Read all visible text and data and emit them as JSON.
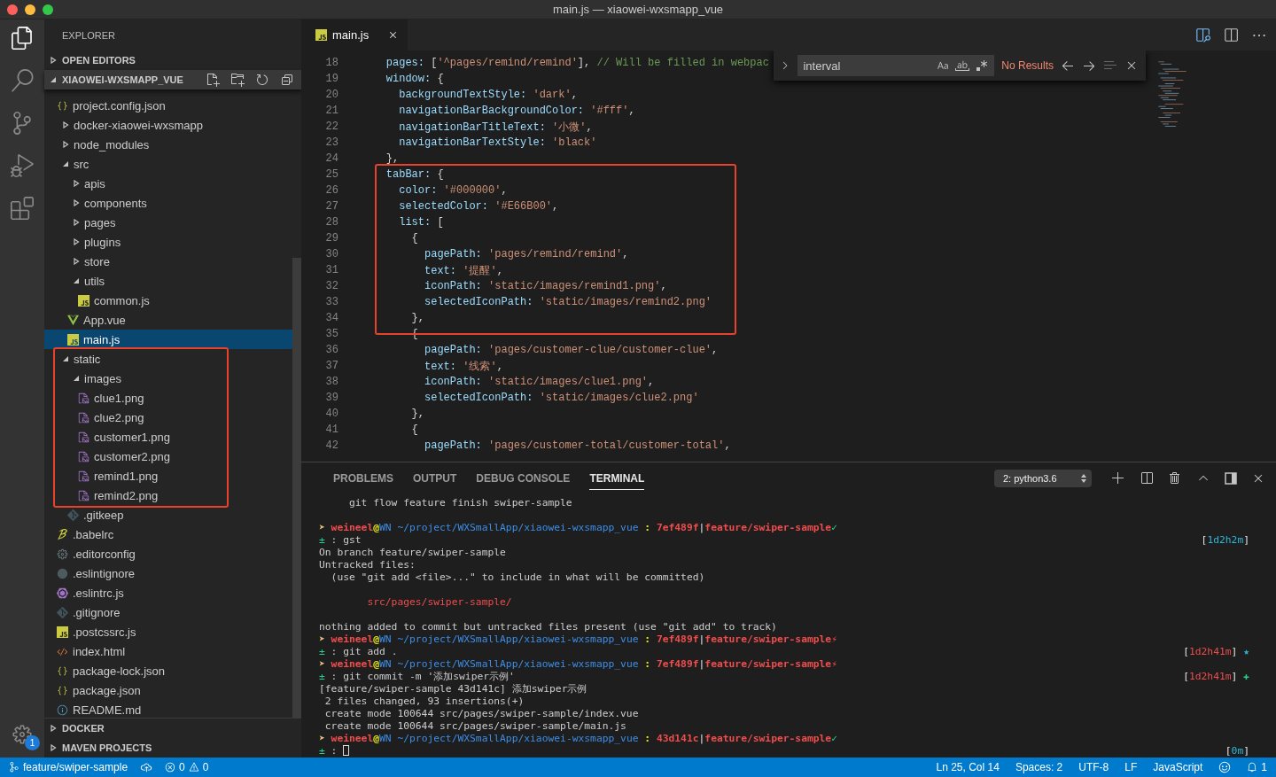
{
  "window": {
    "title": "main.js — xiaowei-wxsmapp_vue"
  },
  "activity_bar": {
    "items": [
      {
        "kind": "files",
        "selected": true
      },
      {
        "kind": "search",
        "selected": false
      },
      {
        "kind": "scm",
        "selected": false
      },
      {
        "kind": "debug",
        "selected": false
      },
      {
        "kind": "extensions",
        "selected": false
      }
    ],
    "settings_badge": "1"
  },
  "sidebar": {
    "title": "EXPLORER",
    "sections": [
      {
        "label": "OPEN EDITORS",
        "expanded": false
      },
      {
        "label": "XIAOWEI-WXSMAPP_VUE",
        "expanded": true
      }
    ],
    "tree": [
      {
        "name": "project.config.json",
        "kind": "json",
        "selected": false,
        "annotated": false
      },
      {
        "name": "docker-xiaowei-wxsmapp",
        "kind": "folder",
        "expanded": false,
        "selected": false,
        "annotated": false
      },
      {
        "name": "node_modules",
        "kind": "folder",
        "expanded": false,
        "selected": false,
        "annotated": false
      },
      {
        "name": "src",
        "kind": "folder",
        "expanded": true,
        "selected": false,
        "annotated": false,
        "children": [
          {
            "name": "apis",
            "kind": "folder",
            "expanded": false,
            "selected": false,
            "annotated": false
          },
          {
            "name": "components",
            "kind": "folder",
            "expanded": false,
            "selected": false,
            "annotated": false
          },
          {
            "name": "pages",
            "kind": "folder",
            "expanded": false,
            "selected": false,
            "annotated": false
          },
          {
            "name": "plugins",
            "kind": "folder",
            "expanded": false,
            "selected": false,
            "annotated": false
          },
          {
            "name": "store",
            "kind": "folder",
            "expanded": false,
            "selected": false,
            "annotated": false
          },
          {
            "name": "utils",
            "kind": "folder",
            "expanded": true,
            "selected": false,
            "annotated": false,
            "children": [
              {
                "name": "common.js",
                "kind": "js",
                "selected": false,
                "annotated": false
              }
            ]
          },
          {
            "name": "App.vue",
            "kind": "vue",
            "selected": false,
            "annotated": false
          },
          {
            "name": "main.js",
            "kind": "js",
            "selected": true,
            "annotated": false
          }
        ]
      },
      {
        "name": "static",
        "kind": "folder",
        "expanded": true,
        "selected": false,
        "annotated": true,
        "children": [
          {
            "name": "images",
            "kind": "folder",
            "expanded": true,
            "selected": false,
            "annotated": true,
            "children": [
              {
                "name": "clue1.png",
                "kind": "image",
                "selected": false,
                "annotated": true
              },
              {
                "name": "clue2.png",
                "kind": "image",
                "selected": false,
                "annotated": true
              },
              {
                "name": "customer1.png",
                "kind": "image",
                "selected": false,
                "annotated": true
              },
              {
                "name": "customer2.png",
                "kind": "image",
                "selected": false,
                "annotated": true
              },
              {
                "name": "remind1.png",
                "kind": "image",
                "selected": false,
                "annotated": true
              },
              {
                "name": "remind2.png",
                "kind": "image",
                "selected": false,
                "annotated": true
              }
            ]
          },
          {
            "name": ".gitkeep",
            "kind": "git",
            "selected": false,
            "annotated": false
          }
        ]
      },
      {
        "name": ".babelrc",
        "kind": "babel",
        "selected": false,
        "annotated": false
      },
      {
        "name": ".editorconfig",
        "kind": "gear",
        "selected": false,
        "annotated": false
      },
      {
        "name": ".eslintignore",
        "kind": "dot",
        "selected": false,
        "annotated": false
      },
      {
        "name": ".eslintrc.js",
        "kind": "eslint",
        "selected": false,
        "annotated": false
      },
      {
        "name": ".gitignore",
        "kind": "git",
        "selected": false,
        "annotated": false
      },
      {
        "name": ".postcssrc.js",
        "kind": "js",
        "selected": false,
        "annotated": false
      },
      {
        "name": "index.html",
        "kind": "html",
        "selected": false,
        "annotated": false
      },
      {
        "name": "package-lock.json",
        "kind": "json",
        "selected": false,
        "annotated": false
      },
      {
        "name": "package.json",
        "kind": "json",
        "selected": false,
        "annotated": false
      },
      {
        "name": "README.md",
        "kind": "info",
        "selected": false,
        "annotated": false
      }
    ],
    "bottom_sections": [
      {
        "label": "DOCKER",
        "expanded": false
      },
      {
        "label": "MAVEN PROJECTS",
        "expanded": false
      }
    ]
  },
  "editor": {
    "tabs": [
      {
        "label": "main.js",
        "kind": "js",
        "selected": true
      }
    ],
    "find": {
      "value": "interval",
      "result": "No Results"
    },
    "blocks": [
      {
        "annotated": false,
        "lines": [
          {
            "number": "18",
            "tokens": [
              {
                "kind": "key",
                "text": "    pages:"
              },
              {
                "kind": "punct",
                "text": " ["
              },
              {
                "kind": "str",
                "text": "'^pages/remind/remind'"
              },
              {
                "kind": "punct",
                "text": "],"
              },
              {
                "kind": "comment",
                "text": " // Will be filled in webpac"
              }
            ]
          },
          {
            "number": "19",
            "tokens": [
              {
                "kind": "key",
                "text": "    window:"
              },
              {
                "kind": "punct",
                "text": " {"
              }
            ]
          },
          {
            "number": "20",
            "tokens": [
              {
                "kind": "key",
                "text": "      backgroundTextStyle:"
              },
              {
                "kind": "str",
                "text": " 'dark'"
              },
              {
                "kind": "punct",
                "text": ","
              }
            ]
          },
          {
            "number": "21",
            "tokens": [
              {
                "kind": "key",
                "text": "      navigationBarBackgroundColor:"
              },
              {
                "kind": "str",
                "text": " '#fff'"
              },
              {
                "kind": "punct",
                "text": ","
              }
            ]
          },
          {
            "number": "22",
            "tokens": [
              {
                "kind": "key",
                "text": "      navigationBarTitleText:"
              },
              {
                "kind": "str",
                "text": " '小微'"
              },
              {
                "kind": "punct",
                "text": ","
              }
            ]
          },
          {
            "number": "23",
            "tokens": [
              {
                "kind": "key",
                "text": "      navigationBarTextStyle:"
              },
              {
                "kind": "str",
                "text": " 'black'"
              }
            ]
          },
          {
            "number": "24",
            "tokens": [
              {
                "kind": "punct",
                "text": "    },"
              }
            ]
          }
        ]
      },
      {
        "annotated": true,
        "lines": [
          {
            "number": "25",
            "tokens": [
              {
                "kind": "key",
                "text": "    tabBar:"
              },
              {
                "kind": "punct",
                "text": " {"
              }
            ]
          },
          {
            "number": "26",
            "tokens": [
              {
                "kind": "key",
                "text": "      color:"
              },
              {
                "kind": "str",
                "text": " '#000000'"
              },
              {
                "kind": "punct",
                "text": ","
              }
            ]
          },
          {
            "number": "27",
            "tokens": [
              {
                "kind": "key",
                "text": "      selectedColor:"
              },
              {
                "kind": "str",
                "text": " '#E66B00'"
              },
              {
                "kind": "punct",
                "text": ","
              }
            ]
          },
          {
            "number": "28",
            "tokens": [
              {
                "kind": "key",
                "text": "      list:"
              },
              {
                "kind": "punct",
                "text": " ["
              }
            ]
          },
          {
            "number": "29",
            "tokens": [
              {
                "kind": "punct",
                "text": "        {"
              }
            ]
          },
          {
            "number": "30",
            "tokens": [
              {
                "kind": "key",
                "text": "          pagePath:"
              },
              {
                "kind": "str",
                "text": " 'pages/remind/remind'"
              },
              {
                "kind": "punct",
                "text": ","
              }
            ]
          },
          {
            "number": "31",
            "tokens": [
              {
                "kind": "key",
                "text": "          text:"
              },
              {
                "kind": "str",
                "text": " '提醒'"
              },
              {
                "kind": "punct",
                "text": ","
              }
            ]
          },
          {
            "number": "32",
            "tokens": [
              {
                "kind": "key",
                "text": "          iconPath:"
              },
              {
                "kind": "str",
                "text": " 'static/images/remind1.png'"
              },
              {
                "kind": "punct",
                "text": ","
              }
            ]
          },
          {
            "number": "33",
            "tokens": [
              {
                "kind": "key",
                "text": "          selectedIconPath:"
              },
              {
                "kind": "str",
                "text": " 'static/images/remind2.png'"
              }
            ]
          },
          {
            "number": "34",
            "tokens": [
              {
                "kind": "punct",
                "text": "        },"
              }
            ]
          },
          {
            "number": "35",
            "tokens": [
              {
                "kind": "punct",
                "text": "        {"
              }
            ]
          }
        ]
      },
      {
        "annotated": false,
        "lines": [
          {
            "number": "36",
            "tokens": [
              {
                "kind": "key",
                "text": "          pagePath:"
              },
              {
                "kind": "str",
                "text": " 'pages/customer-clue/customer-clue'"
              },
              {
                "kind": "punct",
                "text": ","
              }
            ]
          },
          {
            "number": "37",
            "tokens": [
              {
                "kind": "key",
                "text": "          text:"
              },
              {
                "kind": "str",
                "text": " '线索'"
              },
              {
                "kind": "punct",
                "text": ","
              }
            ]
          },
          {
            "number": "38",
            "tokens": [
              {
                "kind": "key",
                "text": "          iconPath:"
              },
              {
                "kind": "str",
                "text": " 'static/images/clue1.png'"
              },
              {
                "kind": "punct",
                "text": ","
              }
            ]
          },
          {
            "number": "39",
            "tokens": [
              {
                "kind": "key",
                "text": "          selectedIconPath:"
              },
              {
                "kind": "str",
                "text": " 'static/images/clue2.png'"
              }
            ]
          },
          {
            "number": "40",
            "tokens": [
              {
                "kind": "punct",
                "text": "        },"
              }
            ]
          },
          {
            "number": "41",
            "tokens": [
              {
                "kind": "punct",
                "text": "        {"
              }
            ]
          },
          {
            "number": "42",
            "tokens": [
              {
                "kind": "key",
                "text": "          pagePath:"
              },
              {
                "kind": "str",
                "text": " 'pages/customer-total/customer-total'"
              },
              {
                "kind": "punct",
                "text": ","
              }
            ]
          }
        ]
      }
    ]
  },
  "panel": {
    "tabs": [
      {
        "label": "PROBLEMS",
        "selected": false
      },
      {
        "label": "OUTPUT",
        "selected": false
      },
      {
        "label": "DEBUG CONSOLE",
        "selected": false
      },
      {
        "label": "TERMINAL",
        "selected": true
      }
    ],
    "terminal_select": "2: python3.6",
    "lines": [
      {
        "kind": "text",
        "segments": [
          {
            "kind": "plain",
            "text": "     git flow feature finish swiper-sample"
          }
        ]
      },
      {
        "kind": "blank"
      },
      {
        "kind": "text",
        "segments": [
          {
            "kind": "arrow",
            "text": "➤ "
          },
          {
            "kind": "user",
            "text": "weineel"
          },
          {
            "kind": "at",
            "text": "@"
          },
          {
            "kind": "host",
            "text": "WN"
          },
          {
            "kind": "path",
            "text": " ~/project/WXSmallApp/xiaowei-wxsmapp_vue"
          },
          {
            "kind": "sep",
            "text": " : "
          },
          {
            "kind": "hash",
            "text": "7ef489f"
          },
          {
            "kind": "bar",
            "text": "|"
          },
          {
            "kind": "branch",
            "text": "feature/swiper-sample"
          },
          {
            "kind": "ok",
            "text": "✓"
          }
        ]
      },
      {
        "kind": "text",
        "segments": [
          {
            "kind": "pm",
            "text": "±"
          },
          {
            "kind": "plain",
            "text": " : gst"
          }
        ],
        "right": [
          {
            "kind": "bracket",
            "text": "["
          },
          {
            "kind": "time_ok",
            "text": "1d2h2m"
          },
          {
            "kind": "bracket",
            "text": "]"
          }
        ]
      },
      {
        "kind": "text",
        "segments": [
          {
            "kind": "plain",
            "text": "On branch feature/swiper-sample"
          }
        ]
      },
      {
        "kind": "text",
        "segments": [
          {
            "kind": "plain",
            "text": "Untracked files:"
          }
        ]
      },
      {
        "kind": "text",
        "segments": [
          {
            "kind": "plain",
            "text": "  (use \"git add <file>...\" to include in what will be committed)"
          }
        ]
      },
      {
        "kind": "blank"
      },
      {
        "kind": "text",
        "segments": [
          {
            "kind": "untracked",
            "text": "        src/pages/swiper-sample/"
          }
        ]
      },
      {
        "kind": "blank"
      },
      {
        "kind": "text",
        "segments": [
          {
            "kind": "plain",
            "text": "nothing added to commit but untracked files present (use \"git add\" to track)"
          }
        ]
      },
      {
        "kind": "text",
        "segments": [
          {
            "kind": "arrow",
            "text": "➤ "
          },
          {
            "kind": "user",
            "text": "weineel"
          },
          {
            "kind": "at",
            "text": "@"
          },
          {
            "kind": "host",
            "text": "WN"
          },
          {
            "kind": "path",
            "text": " ~/project/WXSmallApp/xiaowei-wxsmapp_vue"
          },
          {
            "kind": "sep",
            "text": " : "
          },
          {
            "kind": "hash",
            "text": "7ef489f"
          },
          {
            "kind": "bar",
            "text": "|"
          },
          {
            "kind": "branch",
            "text": "feature/swiper-sample"
          },
          {
            "kind": "dirty",
            "text": "⚡"
          }
        ]
      },
      {
        "kind": "text",
        "segments": [
          {
            "kind": "pm",
            "text": "±"
          },
          {
            "kind": "plain",
            "text": " : git add ."
          }
        ],
        "right": [
          {
            "kind": "bracket",
            "text": "["
          },
          {
            "kind": "time_bad",
            "text": "1d2h41m"
          },
          {
            "kind": "bracket",
            "text": "]"
          },
          {
            "kind": "star",
            "text": " ★"
          }
        ]
      },
      {
        "kind": "text",
        "segments": [
          {
            "kind": "arrow",
            "text": "➤ "
          },
          {
            "kind": "user",
            "text": "weineel"
          },
          {
            "kind": "at",
            "text": "@"
          },
          {
            "kind": "host",
            "text": "WN"
          },
          {
            "kind": "path",
            "text": " ~/project/WXSmallApp/xiaowei-wxsmapp_vue"
          },
          {
            "kind": "sep",
            "text": " : "
          },
          {
            "kind": "hash",
            "text": "7ef489f"
          },
          {
            "kind": "bar",
            "text": "|"
          },
          {
            "kind": "branch",
            "text": "feature/swiper-sample"
          },
          {
            "kind": "dirty",
            "text": "⚡"
          }
        ]
      },
      {
        "kind": "text",
        "segments": [
          {
            "kind": "pm",
            "text": "±"
          },
          {
            "kind": "plain",
            "text": " : git commit -m '添加swiper示例'"
          }
        ],
        "right": [
          {
            "kind": "bracket",
            "text": "["
          },
          {
            "kind": "time_bad",
            "text": "1d2h41m"
          },
          {
            "kind": "bracket",
            "text": "]"
          },
          {
            "kind": "plus",
            "text": " ✚"
          }
        ]
      },
      {
        "kind": "text",
        "segments": [
          {
            "kind": "plain",
            "text": "[feature/swiper-sample 43d141c] 添加swiper示例"
          }
        ]
      },
      {
        "kind": "text",
        "segments": [
          {
            "kind": "plain",
            "text": " 2 files changed, 93 insertions(+)"
          }
        ]
      },
      {
        "kind": "text",
        "segments": [
          {
            "kind": "plain",
            "text": " create mode 100644 src/pages/swiper-sample/index.vue"
          }
        ]
      },
      {
        "kind": "text",
        "segments": [
          {
            "kind": "plain",
            "text": " create mode 100644 src/pages/swiper-sample/main.js"
          }
        ]
      },
      {
        "kind": "text",
        "segments": [
          {
            "kind": "arrow",
            "text": "➤ "
          },
          {
            "kind": "user",
            "text": "weineel"
          },
          {
            "kind": "at",
            "text": "@"
          },
          {
            "kind": "host",
            "text": "WN"
          },
          {
            "kind": "path",
            "text": " ~/project/WXSmallApp/xiaowei-wxsmapp_vue"
          },
          {
            "kind": "sep",
            "text": " : "
          },
          {
            "kind": "hash",
            "text": "43d141c"
          },
          {
            "kind": "bar",
            "text": "|"
          },
          {
            "kind": "branch",
            "text": "feature/swiper-sample"
          },
          {
            "kind": "ok",
            "text": "✓"
          }
        ]
      },
      {
        "kind": "text",
        "cursor": true,
        "segments": [
          {
            "kind": "pm",
            "text": "±"
          },
          {
            "kind": "plain",
            "text": " :"
          }
        ],
        "right": [
          {
            "kind": "bracket",
            "text": "["
          },
          {
            "kind": "time_ok",
            "text": "0m"
          },
          {
            "kind": "bracket",
            "text": "]"
          }
        ]
      }
    ]
  },
  "status_bar": {
    "branch": "feature/swiper-sample",
    "errors": "0",
    "warnings": "0",
    "items": [
      "Ln 25, Col 14",
      "Spaces: 2",
      "UTF-8",
      "LF",
      "JavaScript"
    ],
    "notifications": "1"
  }
}
